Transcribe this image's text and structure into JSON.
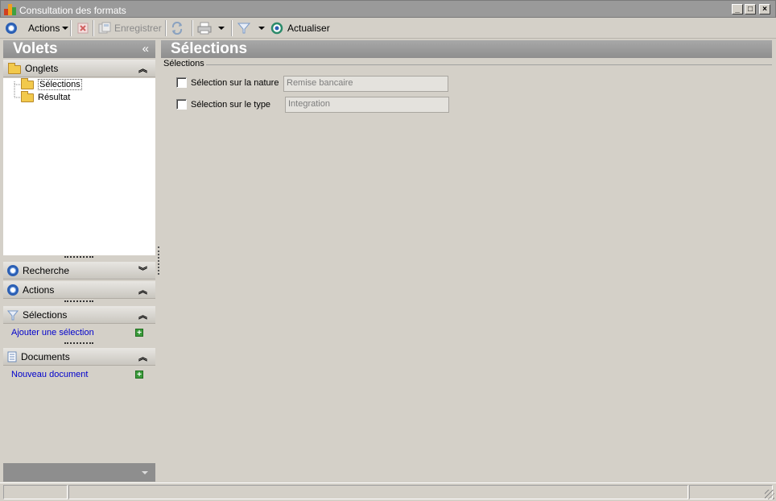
{
  "window": {
    "title": "Consultation des formats",
    "minimize": "_",
    "maximize": "□",
    "close": "×"
  },
  "toolbar": {
    "actions_label": "Actions",
    "save_label": "Enregistrer",
    "refresh_label": "Actualiser"
  },
  "left_panel": {
    "header": "Volets",
    "collapse_glyph": "«",
    "onglets": {
      "title": "Onglets",
      "items": [
        {
          "label": "Sélections"
        },
        {
          "label": "Résultat"
        }
      ]
    },
    "recherche": {
      "title": "Recherche"
    },
    "actions": {
      "title": "Actions"
    },
    "selections": {
      "title": "Sélections",
      "link": "Ajouter une sélection"
    },
    "documents": {
      "title": "Documents",
      "link": "Nouveau document"
    }
  },
  "main": {
    "header": "Sélections",
    "group_label": "Sélections",
    "rows": [
      {
        "label": "Sélection sur la nature",
        "value": "Remise bancaire"
      },
      {
        "label": "Sélection sur le type",
        "value": "Integration"
      }
    ]
  },
  "colors": {
    "header_gray": "#8e8e8e",
    "accent_blue": "#2b5fb4",
    "link_blue": "#0000cc",
    "plus_green": "#3a9a3a"
  }
}
